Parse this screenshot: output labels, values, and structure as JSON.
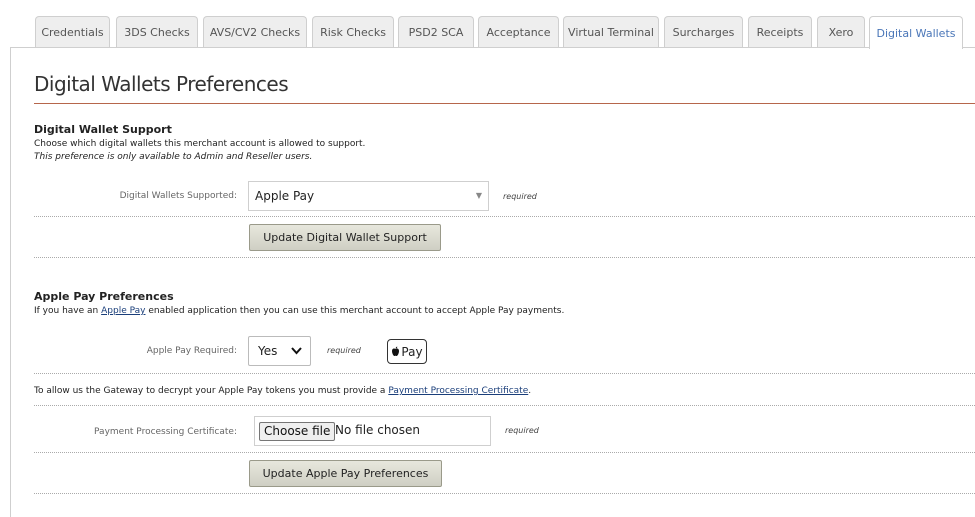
{
  "tabs": [
    {
      "label": "Credentials"
    },
    {
      "label": "3DS Checks"
    },
    {
      "label": "AVS/CV2 Checks"
    },
    {
      "label": "Risk Checks"
    },
    {
      "label": "PSD2 SCA"
    },
    {
      "label": "Acceptance"
    },
    {
      "label": "Virtual Terminal"
    },
    {
      "label": "Surcharges"
    },
    {
      "label": "Receipts"
    },
    {
      "label": "Xero"
    },
    {
      "label": "Digital Wallets",
      "active": true
    }
  ],
  "colors": {
    "active_tab_text": "#4a76b8",
    "title_rule": "#b6664b",
    "link": "#1a3e7a"
  },
  "page": {
    "title": "Digital Wallets Preferences"
  },
  "wallet_support": {
    "title": "Digital Wallet Support",
    "description": "Choose which digital wallets this merchant account is allowed to support.",
    "note": "This preference is only available to Admin and Reseller users.",
    "field_label": "Digital Wallets Supported:",
    "selected": "Apple Pay",
    "required": "required",
    "update_button": "Update Digital Wallet Support",
    "caret_icon": "caret-down-icon"
  },
  "apple_pay": {
    "title": "Apple Pay Preferences",
    "desc_before": "If you have an ",
    "desc_link": "Apple Pay",
    "desc_after": " enabled application then you can use this merchant account to accept Apple Pay payments.",
    "required_label": "Apple Pay Required:",
    "required_value": "Yes",
    "required_text": "required",
    "mark_text": "Pay",
    "mark_icon": "apple-logo-icon",
    "cert_desc_before": "To allow us the Gateway to decrypt your Apple Pay tokens you must provide a ",
    "cert_desc_link": "Payment Processing Certificate",
    "cert_desc_after": ".",
    "cert_label": "Payment Processing Certificate:",
    "choose_file": "Choose file",
    "no_file": "No file chosen",
    "cert_required": "required",
    "update_button": "Update Apple Pay Preferences"
  }
}
